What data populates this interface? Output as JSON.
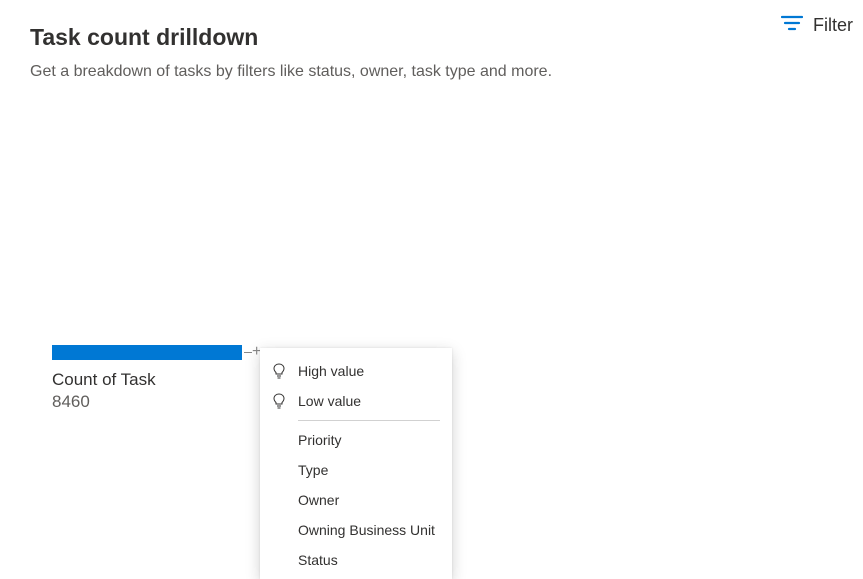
{
  "header": {
    "title": "Task count drilldown",
    "subtitle": "Get a breakdown of tasks by filters like status, owner, task type and more.",
    "filter_label": "Filter"
  },
  "chart_data": {
    "type": "bar",
    "categories": [
      "Count of Task"
    ],
    "values": [
      8460
    ],
    "title": "",
    "xlabel": "",
    "ylabel": ""
  },
  "metric": {
    "label": "Count of Task",
    "value": "8460"
  },
  "menu": {
    "suggested": [
      {
        "label": "High value"
      },
      {
        "label": "Low value"
      }
    ],
    "fields": [
      {
        "label": "Priority"
      },
      {
        "label": "Type"
      },
      {
        "label": "Owner"
      },
      {
        "label": "Owning Business Unit"
      },
      {
        "label": "Status"
      }
    ]
  },
  "colors": {
    "accent": "#0078d4"
  }
}
